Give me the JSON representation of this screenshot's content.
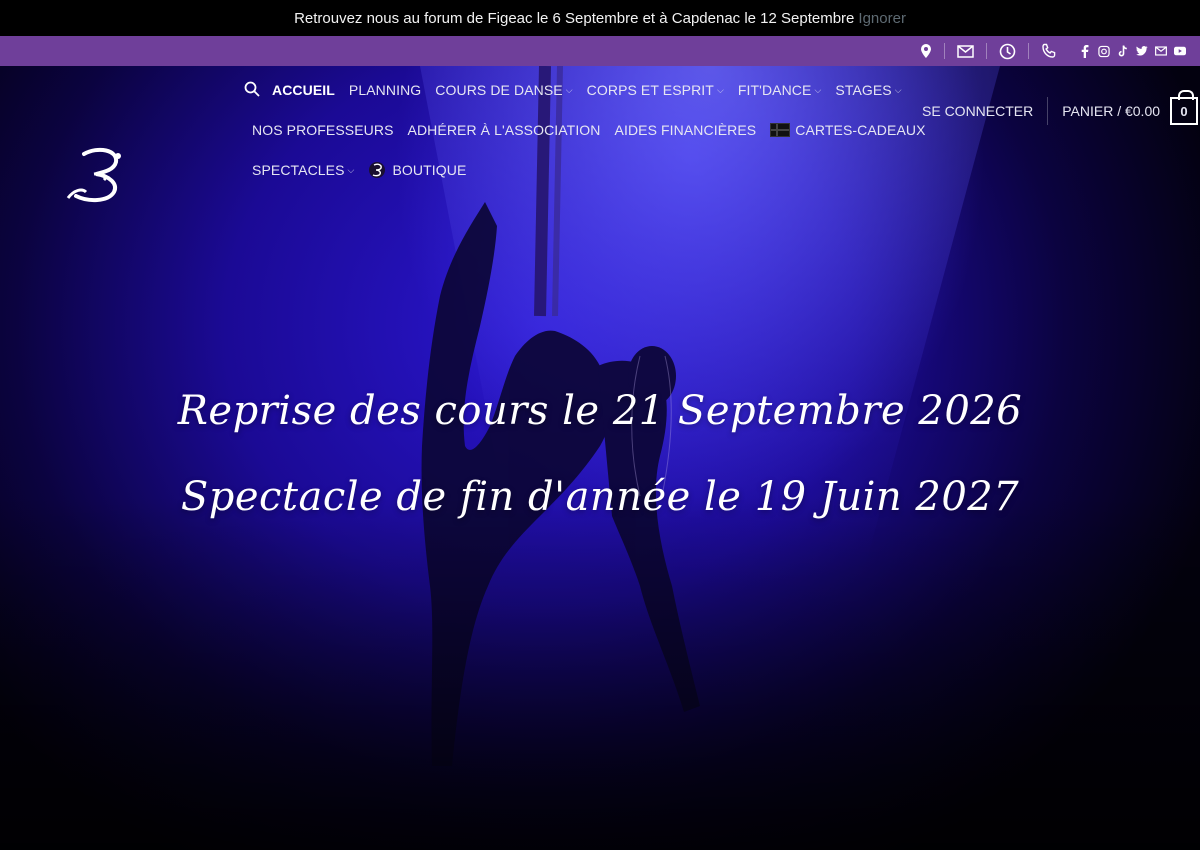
{
  "announcement": {
    "message": "Retrouvez nous au forum de Figeac le 6 Septembre et à Capdenac le 12 Septembre",
    "dismiss_label": "Ignorer"
  },
  "topbar": {
    "contact_icons": [
      "location-icon",
      "mail-icon",
      "clock-icon",
      "phone-icon"
    ],
    "social_icons": [
      "facebook-icon",
      "instagram-icon",
      "tiktok-icon",
      "twitter-icon",
      "mail-icon",
      "youtube-icon"
    ],
    "background": "#6f3f9a"
  },
  "nav": {
    "row1": {
      "accueil": "ACCUEIL",
      "planning": "PLANNING",
      "cours": "COURS DE DANSE",
      "corps": "CORPS ET ESPRIT",
      "fitdance": "FIT'DANCE",
      "stages": "STAGES"
    },
    "row2": {
      "profs": "NOS PROFESSEURS",
      "adherer": "ADHÉRER À L'ASSOCIATION",
      "aides": "AIDES FINANCIÈRES",
      "cartes": "CARTES-CADEAUX"
    },
    "row3": {
      "spectacles": "SPECTACLES",
      "boutique": "BOUTIQUE"
    }
  },
  "header": {
    "login_label": "SE CONNECTER",
    "cart_label": "PANIER / €0.00",
    "cart_count": "0"
  },
  "hero": {
    "line1": "Reprise des cours le 21 Septembre 2026",
    "line2": "Spectacle de fin d'année le 19 Juin 2027"
  }
}
